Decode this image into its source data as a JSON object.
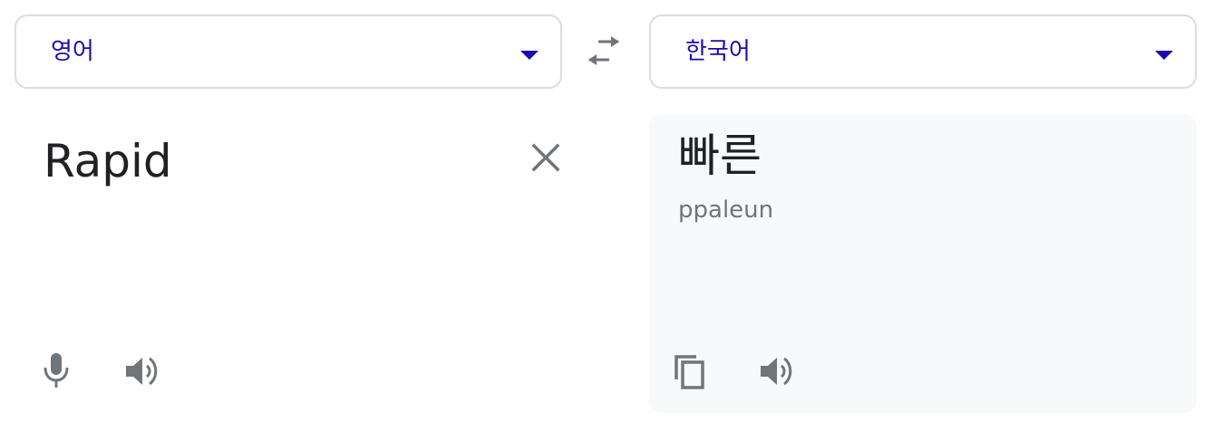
{
  "source_lang": {
    "label": "영어"
  },
  "target_lang": {
    "label": "한국어"
  },
  "source": {
    "text": "Rapid"
  },
  "result": {
    "text": "빠른",
    "romanization": "ppaleun"
  },
  "icons": {
    "dropdown": "chevron-down-icon",
    "swap": "swap-icon",
    "clear": "close-icon",
    "mic": "microphone-icon",
    "speaker": "speaker-icon",
    "copy": "copy-icon"
  },
  "colors": {
    "accent": "#1a0dab",
    "icon": "#70757a",
    "text": "#202124",
    "border": "#dadce0",
    "panel": "#f8f9fa"
  }
}
